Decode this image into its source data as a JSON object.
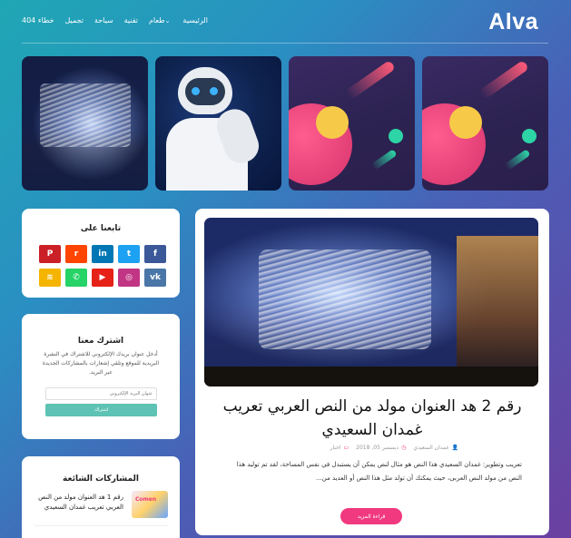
{
  "header": {
    "logo": "Alva",
    "nav": [
      {
        "label": "الرئيسية"
      },
      {
        "label": "طعام",
        "has_dropdown": true
      },
      {
        "label": "تقنية"
      },
      {
        "label": "سياحة"
      },
      {
        "label": "تجميل"
      },
      {
        "label": "خطاء 404"
      }
    ]
  },
  "thumbnails": [
    {
      "alt_icon": "city-light-trails-image"
    },
    {
      "alt_icon": "robot-image"
    },
    {
      "alt_icon": "space-illustration-image"
    },
    {
      "alt_icon": "space-illustration-image"
    }
  ],
  "sidebar": {
    "follow": {
      "title": "تابعنا على",
      "networks": [
        {
          "icon": "facebook-icon",
          "glyph": "f",
          "color": "#3b5998"
        },
        {
          "icon": "twitter-icon",
          "glyph": "t",
          "color": "#1da1f2"
        },
        {
          "icon": "linkedin-icon",
          "glyph": "in",
          "color": "#0077b5"
        },
        {
          "icon": "reddit-icon",
          "glyph": "r",
          "color": "#ff4500"
        },
        {
          "icon": "pinterest-icon",
          "glyph": "P",
          "color": "#cb2027"
        },
        {
          "icon": "vk-icon",
          "glyph": "vk",
          "color": "#4a76a8"
        },
        {
          "icon": "instagram-icon",
          "glyph": "◎",
          "color": "#c13584"
        },
        {
          "icon": "youtube-icon",
          "glyph": "▶",
          "color": "#e62117"
        },
        {
          "icon": "whatsapp-icon",
          "glyph": "✆",
          "color": "#25d366"
        },
        {
          "icon": "rss-icon",
          "glyph": "≋",
          "color": "#f4b400"
        }
      ]
    },
    "subscribe": {
      "title": "اشترك معنا",
      "description": "أدخل عنوان بريدك الإلكتروني للاشتراك في النشرة البريدية للموقع وتلقي إشعارات بالمشاركات الجديدة عبر البريد.",
      "email_placeholder": "عنوان البريد الإلكتروني",
      "button_label": "اشتراك"
    },
    "popular": {
      "title": "المشاركات الشائعة",
      "items": [
        {
          "title": "رقم 1 هد العنوان مولد من النص العربي تعريب غمدان السعيدي",
          "thumb_text": "Comen"
        }
      ]
    }
  },
  "post": {
    "title": "رقم 2 هد العنوان مولد من النص العربي تعريب غمدان السعيدي",
    "author": "غمدان السعيدي",
    "date": "ديسمبر 05, 2018",
    "category": "اخبار",
    "excerpt": "تعريب وتطوير: غمدان السعيدي هذا النص هو مثال لنص يمكن أن يستبدل في نفس المساحة، لقد تم توليد هذا النص من مولد النص العربى، حيث يمكنك أن تولد مثل هذا النص أو العديد من...",
    "read_more": "قراءة المزيد"
  }
}
